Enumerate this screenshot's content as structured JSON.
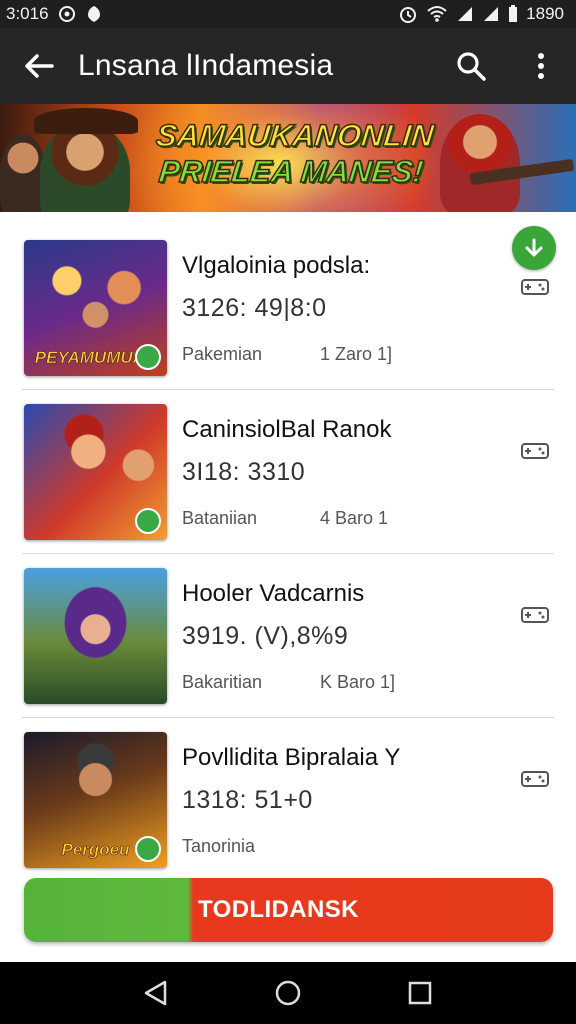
{
  "status_bar": {
    "time": "3:016",
    "battery_text": "1890",
    "left_icons": [
      "alarm-clock-icon",
      "shield-icon"
    ],
    "right_icons": [
      "alarm-icon",
      "wifi-icon",
      "signal-icon",
      "signal-icon",
      "battery-icon"
    ]
  },
  "app_bar": {
    "title": "Lnsana lIndamesia",
    "back_icon": "arrow-left-icon",
    "search_icon": "search-icon",
    "menu_icon": "more-vertical-icon"
  },
  "banner": {
    "line1": "SAMAUKANONLIN",
    "line2": "PRIELEA MANES!"
  },
  "items": [
    {
      "name": "Vlgaloinia podsla:",
      "count": "3126: 49|8:0",
      "meta1": "Pakemian",
      "meta2": "1 Zaro 1]",
      "thumb_caption": "PEYAMUMUAE"
    },
    {
      "name": "CaninsiolBal Ranok",
      "count": "3I18: 3310",
      "meta1": "Bataniian",
      "meta2": "4 Baro 1",
      "thumb_caption": ""
    },
    {
      "name": "Hooler Vadcarnis",
      "count": "3919. (V),8%9",
      "meta1": "Bakaritian",
      "meta2": "K Baro 1]",
      "thumb_caption": ""
    },
    {
      "name": "Povllidita Bipralaia Y",
      "count": "1318: 51+0",
      "meta1": "Tanorinia",
      "meta2": "",
      "thumb_caption": "Pergoeu"
    }
  ],
  "cta": {
    "label": "TODLIDANSK"
  },
  "colors": {
    "accent_green": "#3aa63a",
    "accent_red": "#e63a1c",
    "appbar": "#262626"
  }
}
